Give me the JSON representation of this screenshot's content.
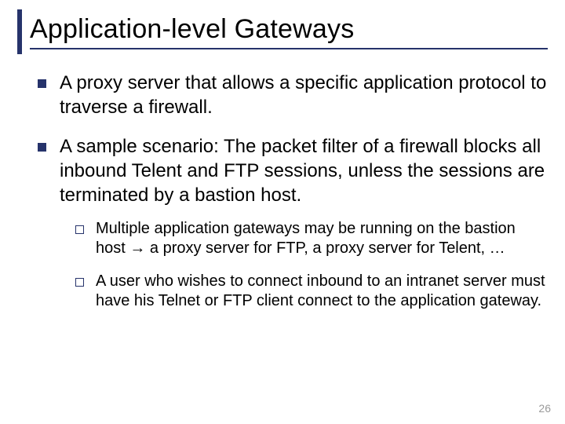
{
  "slide": {
    "title": "Application-level Gateways",
    "bullets": [
      {
        "text": "A proxy server that allows a specific application protocol to traverse a firewall."
      },
      {
        "text": "A sample scenario: The packet filter of a firewall blocks all inbound Telent and FTP sessions, unless the sessions are terminated by a bastion host.",
        "sub": [
          {
            "pre": "Multiple application gateways may be running on the bastion host ",
            "arrow": "→",
            "post": " a proxy server for FTP, a proxy server for Telent, …"
          },
          {
            "text": "A user who wishes to connect inbound to an intranet server must have his Telnet or FTP client connect to the application gateway."
          }
        ]
      }
    ],
    "page_number": "26"
  }
}
